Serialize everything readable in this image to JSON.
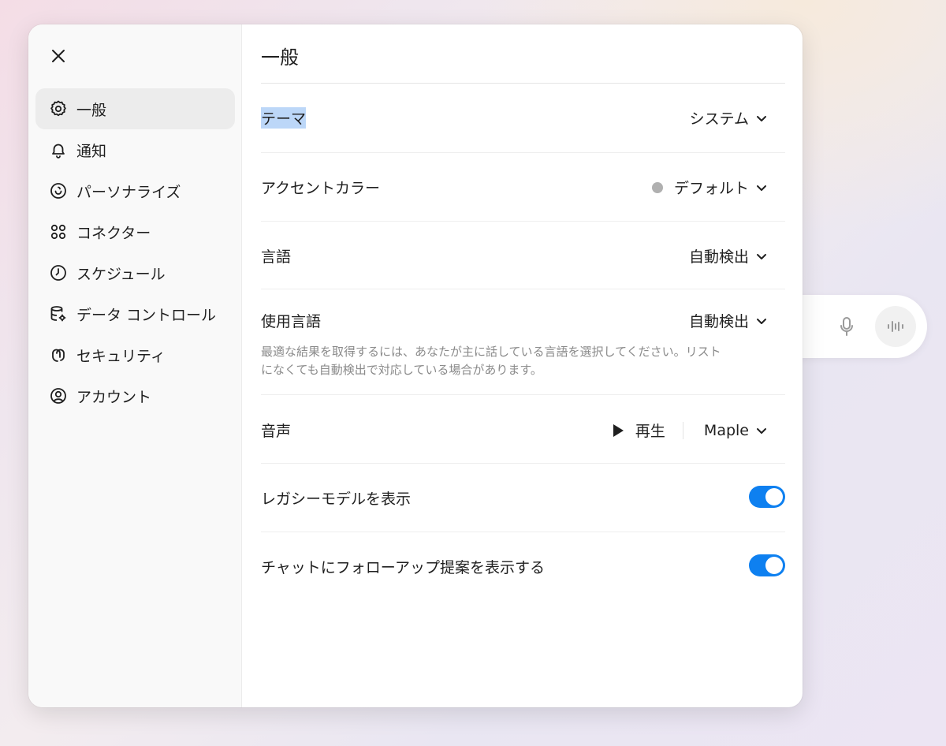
{
  "sidebar": {
    "items": [
      {
        "label": "一般",
        "icon": "gear-icon"
      },
      {
        "label": "通知",
        "icon": "bell-icon"
      },
      {
        "label": "パーソナライズ",
        "icon": "personalize-icon"
      },
      {
        "label": "コネクター",
        "icon": "connectors-icon"
      },
      {
        "label": "スケジュール",
        "icon": "clock-icon"
      },
      {
        "label": "データ コントロール",
        "icon": "database-gear-icon"
      },
      {
        "label": "セキュリティ",
        "icon": "security-icon"
      },
      {
        "label": "アカウント",
        "icon": "account-icon"
      }
    ],
    "active_index": 0
  },
  "main": {
    "title": "一般",
    "theme": {
      "label": "テーマ",
      "value": "システム"
    },
    "accent": {
      "label": "アクセントカラー",
      "value": "デフォルト",
      "dot_color": "#b0b0b0"
    },
    "language": {
      "label": "言語",
      "value": "自動検出"
    },
    "spoken_language": {
      "label": "使用言語",
      "value": "自動検出",
      "description": "最適な結果を取得するには、あなたが主に話している言語を選択してください。リストになくても自動検出で対応している場合があります。"
    },
    "voice": {
      "label": "音声",
      "play_label": "再生",
      "value": "Maple"
    },
    "legacy_models": {
      "label": "レガシーモデルを表示",
      "enabled": true
    },
    "follow_up": {
      "label": "チャットにフォローアップ提案を表示する",
      "enabled": true
    }
  },
  "colors": {
    "accent": "#0e80f0",
    "selection_highlight": "#bcd7f8",
    "sidebar_bg": "#f9f9f9",
    "active_item_bg": "#ececec"
  }
}
